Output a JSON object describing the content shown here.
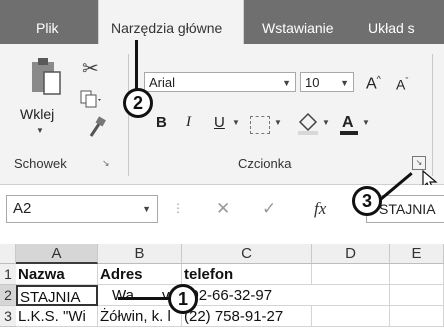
{
  "tabs": [
    {
      "label": "Plik"
    },
    {
      "label": "Narzędzia główne"
    },
    {
      "label": "Wstawianie"
    },
    {
      "label": "Układ s"
    }
  ],
  "clipboard": {
    "paste_label": "Wklej",
    "group_label": "Schowek"
  },
  "font": {
    "name": "Arial",
    "size": "10",
    "grow": "A",
    "shrink": "A",
    "bold": "B",
    "italic": "I",
    "underline": "U",
    "group_label": "Czcionka"
  },
  "formula_bar": {
    "name_box": "A2",
    "fx": "fx",
    "content": "STAJNIA"
  },
  "sheet": {
    "columns": [
      "A",
      "B",
      "C",
      "D",
      "E"
    ],
    "rows": [
      {
        "num": "1",
        "cells": [
          "Nazwa",
          "Adres",
          "telefon",
          "",
          ""
        ]
      },
      {
        "num": "2",
        "cells": [
          "STAJNIA",
          "Wa",
          "va 602-66-32-97",
          "",
          ""
        ]
      },
      {
        "num": "3",
        "cells": [
          "L.K.S. \"Wi",
          "Żółwin, k. l",
          "(22) 758-91-27",
          "",
          ""
        ]
      }
    ]
  },
  "callouts": [
    "1",
    "2",
    "3"
  ]
}
